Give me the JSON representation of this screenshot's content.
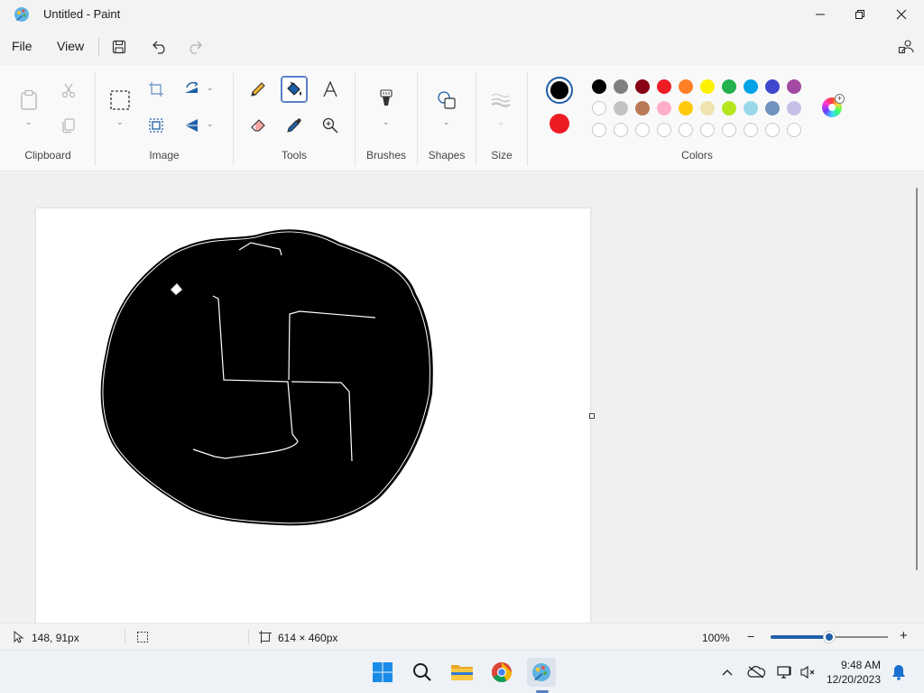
{
  "window": {
    "title": "Untitled - Paint"
  },
  "menu": {
    "file": "File",
    "view": "View"
  },
  "ribbon": {
    "clipboard_label": "Clipboard",
    "image_label": "Image",
    "tools_label": "Tools",
    "brushes_label": "Brushes",
    "shapes_label": "Shapes",
    "size_label": "Size",
    "colors_label": "Colors",
    "active_tool": "fill-bucket"
  },
  "colors": {
    "primary": "#000000",
    "secondary": "#ed1c24",
    "palette_row1": [
      "#000000",
      "#7f7f7f",
      "#880015",
      "#ed1c24",
      "#ff7f27",
      "#fff200",
      "#22b14c",
      "#00a2e8",
      "#3f48cc",
      "#a349a4"
    ],
    "palette_row2": [
      "#ffffff",
      "#c3c3c3",
      "#b97a57",
      "#ffaec9",
      "#ffc90e",
      "#efe4b0",
      "#b5e61d",
      "#99d9ea",
      "#7092be",
      "#c8bfe7"
    ],
    "palette_row3_count": 10
  },
  "status": {
    "cursor_pos": "148, 91px",
    "canvas_size": "614 × 460px",
    "zoom": "100%",
    "zoom_level": 0.5
  },
  "taskbar": {
    "time": "9:48 AM",
    "date": "12/20/2023"
  }
}
